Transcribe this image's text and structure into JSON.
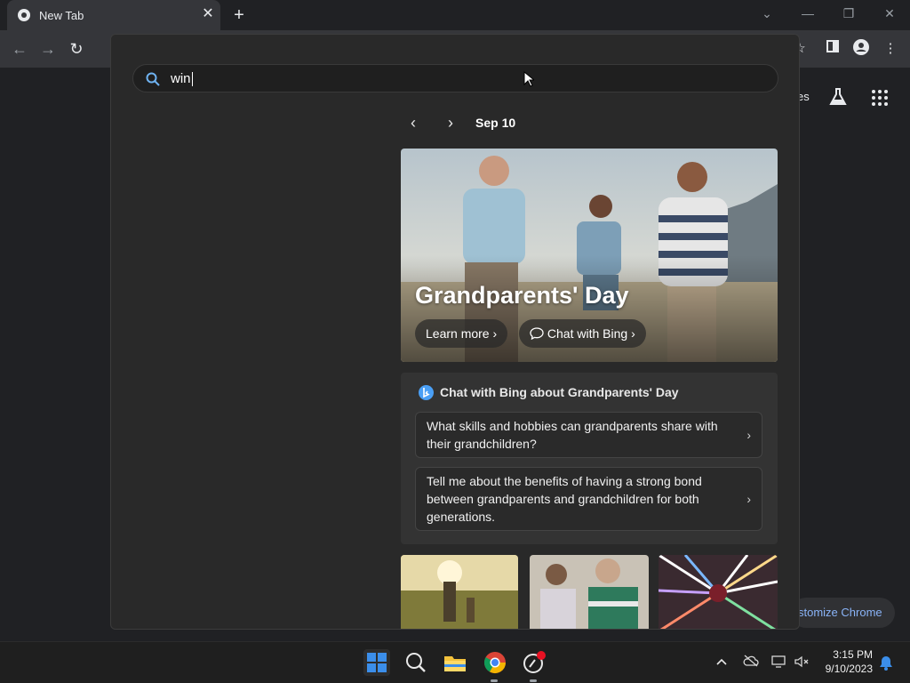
{
  "browser": {
    "tab_title": "New Tab",
    "tab_close": "✕",
    "new_tab": "+"
  },
  "toolbar": {
    "back": "←",
    "forward": "→",
    "reload": "↻"
  },
  "page": {
    "side_text": "es",
    "customize_label": "stomize Chrome"
  },
  "search": {
    "query": "win"
  },
  "date_nav": {
    "prev": "‹",
    "next": "›",
    "date": "Sep 10"
  },
  "hero": {
    "title": "Grandparents' Day",
    "learn_more": "Learn more",
    "chat_with_bing": "Chat with Bing"
  },
  "chat": {
    "heading": "Chat with Bing about Grandparents' Day",
    "prompts": [
      "What skills and hobbies can grandparents share with their grandchildren?",
      "Tell me about the benefits of having a strong bond between grandparents and grandchildren for both generations."
    ]
  },
  "taskbar": {
    "time": "3:15 PM",
    "date": "9/10/2023"
  },
  "colors": {
    "accent_blue": "#8ab4f8",
    "bing_blue": "#4a9ff5",
    "windows_blue": "#3b8eea"
  }
}
